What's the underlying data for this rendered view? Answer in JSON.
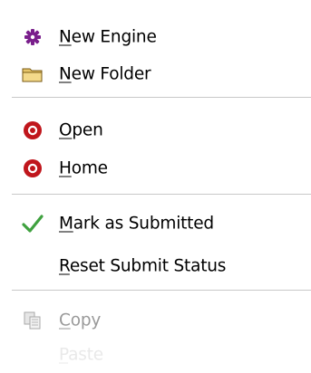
{
  "menu": {
    "items": [
      {
        "key": "new_engine",
        "label": "New Engine",
        "mnemonic": "N",
        "icon": "gear-icon"
      },
      {
        "key": "new_folder",
        "label": "New Folder",
        "mnemonic": "N",
        "icon": "folder-icon"
      },
      {
        "key": "open",
        "label": "Open",
        "mnemonic": "O",
        "icon": "red-circle-icon"
      },
      {
        "key": "home",
        "label": "Home",
        "mnemonic": "H",
        "icon": "red-circle-icon"
      },
      {
        "key": "mark_submitted",
        "label": "Mark as Submitted",
        "mnemonic": "M",
        "icon": "checkmark-icon"
      },
      {
        "key": "reset_submit",
        "label": "Reset Submit Status",
        "mnemonic": "R",
        "icon": ""
      },
      {
        "key": "copy",
        "label": "Copy",
        "mnemonic": "C",
        "icon": "copy-icon",
        "disabled": true
      },
      {
        "key": "paste",
        "label": "Paste",
        "mnemonic": "P",
        "icon": "",
        "disabled": true
      }
    ]
  },
  "colors": {
    "gear": "#7a1f8c",
    "folder": "#e6c56a",
    "red_circle": "#c0161c",
    "checkmark": "#3fa13f",
    "disabled_text": "#9a9a9a",
    "separator": "#c8c8c8"
  }
}
